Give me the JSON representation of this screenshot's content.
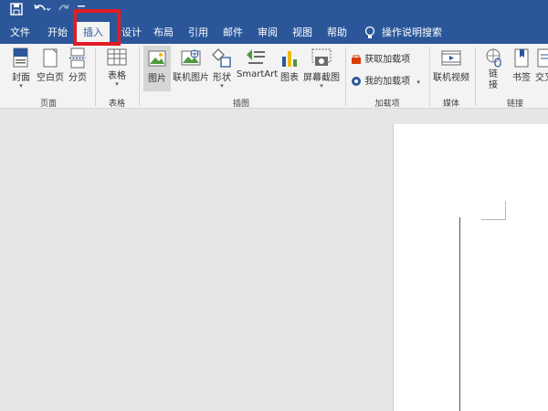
{
  "quick_access": {
    "save_icon": "save-icon",
    "undo_icon": "undo-icon",
    "redo_icon": "redo-icon"
  },
  "tabs": [
    {
      "label": "文件"
    },
    {
      "label": "开始"
    },
    {
      "label": "插入"
    },
    {
      "label": "设计"
    },
    {
      "label": "布局"
    },
    {
      "label": "引用"
    },
    {
      "label": "邮件"
    },
    {
      "label": "审阅"
    },
    {
      "label": "视图"
    },
    {
      "label": "帮助"
    }
  ],
  "search": {
    "icon": "lightbulb-icon",
    "placeholder": "操作说明搜索"
  },
  "ribbon": {
    "pages_group": {
      "label": "页面",
      "buttons": [
        {
          "label": "封面"
        },
        {
          "label": "空白页"
        },
        {
          "label": "分页"
        }
      ]
    },
    "tables_group": {
      "label": "表格",
      "buttons": [
        {
          "label": "表格"
        }
      ]
    },
    "illustrations_group": {
      "label": "插图",
      "buttons": [
        {
          "label": "图片"
        },
        {
          "label": "联机图片"
        },
        {
          "label": "形状"
        },
        {
          "label": "SmartArt"
        },
        {
          "label": "图表"
        },
        {
          "label": "屏幕截图"
        }
      ]
    },
    "addins_group": {
      "label": "加载项",
      "buttons": [
        {
          "label": "获取加载项"
        },
        {
          "label": "我的加载项"
        }
      ]
    },
    "media_group": {
      "label": "媒体",
      "buttons": [
        {
          "label": "联机视频"
        }
      ]
    },
    "links_group": {
      "label": "链接",
      "buttons": [
        {
          "label": "链接"
        },
        {
          "label": "书签"
        },
        {
          "label": "交叉"
        }
      ]
    }
  },
  "colors": {
    "accent": "#2b579a",
    "highlight": "#e31b23"
  }
}
